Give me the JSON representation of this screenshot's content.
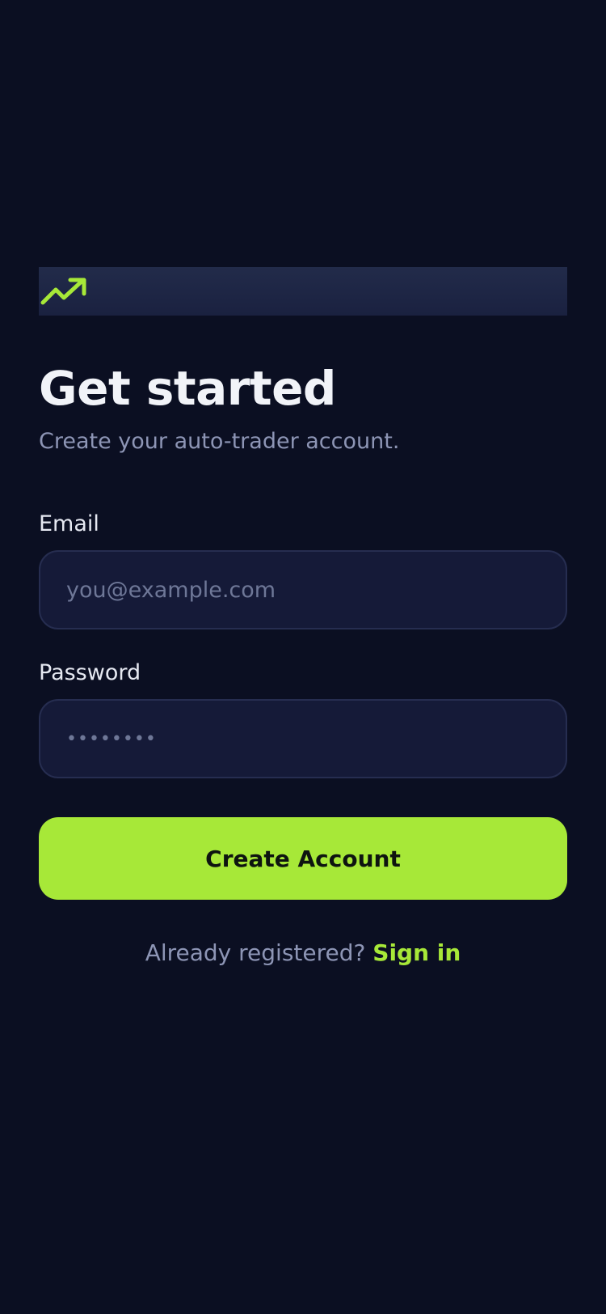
{
  "brand": {
    "icon": "trending-up-icon",
    "accent_color": "#a7e838"
  },
  "header": {
    "title": "Get started",
    "subtitle": "Create your auto-trader account."
  },
  "form": {
    "email": {
      "label": "Email",
      "placeholder": "you@example.com",
      "value": ""
    },
    "password": {
      "label": "Password",
      "placeholder": "••••••••",
      "value": ""
    },
    "submit_label": "Create Account"
  },
  "footer": {
    "prompt": "Already registered?",
    "link_label": "Sign in"
  },
  "colors": {
    "background": "#0b0f22",
    "input_background": "#151a38",
    "accent": "#a7e838",
    "muted_text": "#8d95b5"
  }
}
